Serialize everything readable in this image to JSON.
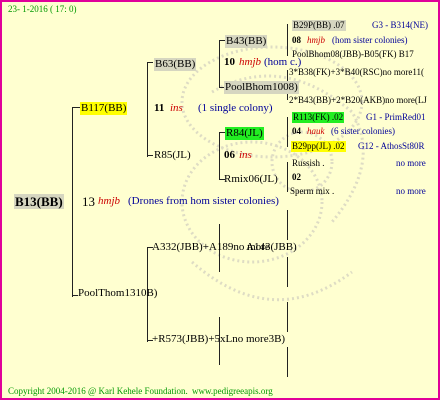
{
  "header": {
    "date": "23- 1-2016 ( 17: 0)"
  },
  "footer": {
    "copyright": "Copyright 2004-2016 @ Karl Kehele Foundation.",
    "url": "www.pedigreeapis.org"
  },
  "root": {
    "label": "B13(BB)",
    "num": "13",
    "name": "hmjb",
    "desc": "(Drones from hom sister colonies)"
  },
  "q1": {
    "label": "B117(BB)",
    "num": "11",
    "name": "ins",
    "desc": "(1 single colony)"
  },
  "q2": {
    "label": "PoolThom1310B)"
  },
  "q11": {
    "label": "B63(BB)"
  },
  "q12": {
    "label": "R85(JL)"
  },
  "q21": {
    "label": "A332(JBB)+A189no more"
  },
  "q21b": {
    "label": "A143(JBB)"
  },
  "q22": {
    "label": "+R573(JBB)+5xLno more3B)"
  },
  "q111": {
    "label": "B43(BB)",
    "num": "10",
    "name": "hmjb",
    "desc": "(hom c.)"
  },
  "q112": {
    "label": "PoolBhom1008)"
  },
  "q121": {
    "label": "R84(JL)",
    "num": "06",
    "name": "ins"
  },
  "q122": {
    "label": "Rmix06(JL)",
    "num": "02"
  },
  "r1": {
    "label": "B29P(BB) .07",
    "ref": "G3 - B314(NE)"
  },
  "r2": {
    "num": "08",
    "name": "hmjb",
    "desc": "(hom sister colonies)"
  },
  "r3": {
    "label": "PoolBhom08(JBB)-B05(FK) B17"
  },
  "r4": {
    "label": "3*B38(FK)+3*B40(RSC)no more11("
  },
  "r5": {
    "label": "2*B43(BB)+2*B20(AKB)no more(LJ"
  },
  "r6": {
    "label": "R113(FK) .02",
    "ref": "G1 - PrimRed01"
  },
  "r7": {
    "num": "04",
    "name": "hauk",
    "desc": "(6 sister colonies)"
  },
  "r8": {
    "label": "B29pp(JL) .02",
    "ref": "G12 - AthosSt80R"
  },
  "r9": {
    "label": "Russish .",
    "ref": "no more"
  },
  "r10": {
    "label": "Sperm mix .",
    "ref": "no more"
  }
}
